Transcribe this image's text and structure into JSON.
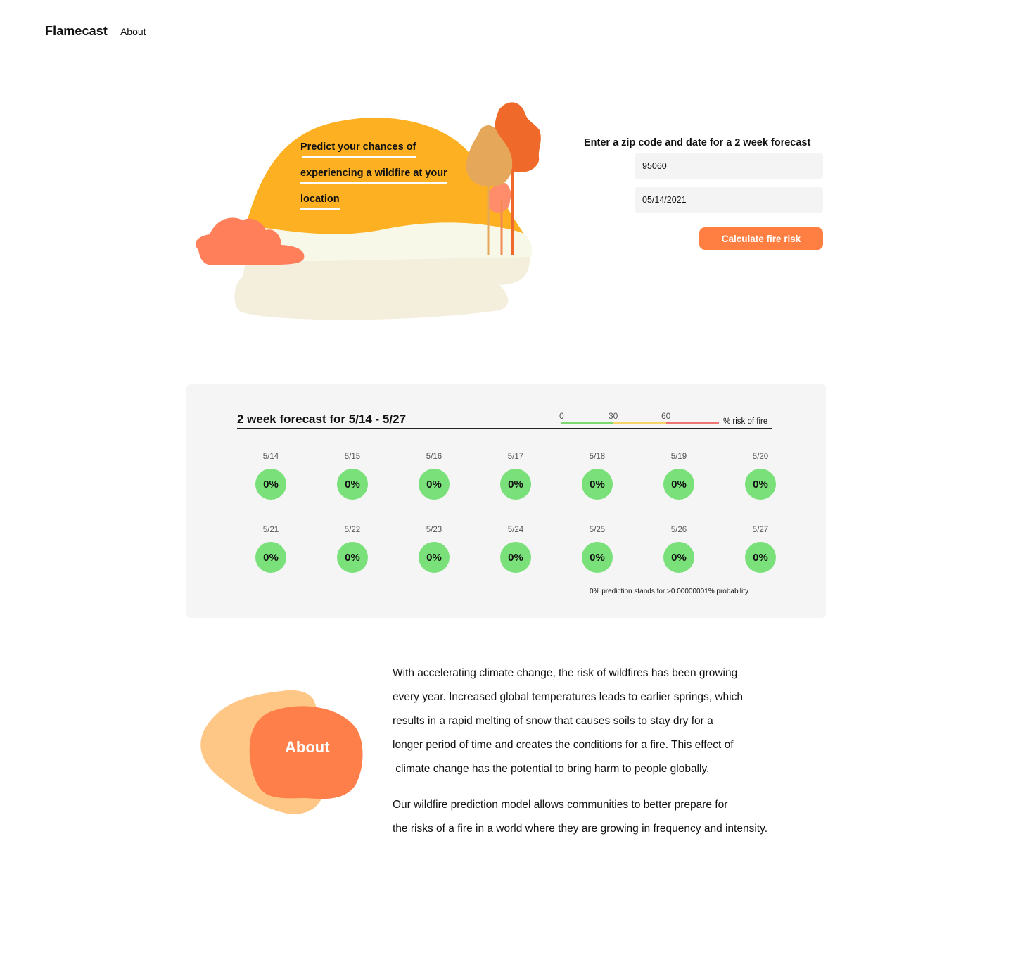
{
  "nav": {
    "brand": "Flamecast",
    "about_link": "About"
  },
  "hero": {
    "lines": [
      "Predict your chances of",
      "experiencing a wildfire at your",
      "location"
    ]
  },
  "form": {
    "title": "Enter a zip code and date for a 2 week forecast",
    "zip_value": "95060",
    "date_value": "05/14/2021",
    "button_label": "Calculate fire risk"
  },
  "forecast": {
    "title": "2 week forecast for 5/14 - 5/27",
    "legend": {
      "ticks": [
        "0",
        "30",
        "60"
      ],
      "unit": "% risk of fire"
    },
    "days": [
      {
        "date": "5/14",
        "risk": "0%"
      },
      {
        "date": "5/15",
        "risk": "0%"
      },
      {
        "date": "5/16",
        "risk": "0%"
      },
      {
        "date": "5/17",
        "risk": "0%"
      },
      {
        "date": "5/18",
        "risk": "0%"
      },
      {
        "date": "5/19",
        "risk": "0%"
      },
      {
        "date": "5/20",
        "risk": "0%"
      },
      {
        "date": "5/21",
        "risk": "0%"
      },
      {
        "date": "5/22",
        "risk": "0%"
      },
      {
        "date": "5/23",
        "risk": "0%"
      },
      {
        "date": "5/24",
        "risk": "0%"
      },
      {
        "date": "5/25",
        "risk": "0%"
      },
      {
        "date": "5/26",
        "risk": "0%"
      },
      {
        "date": "5/27",
        "risk": "0%"
      }
    ],
    "footnote": "0% prediction stands for >0.00000001% probability."
  },
  "about": {
    "label": "About",
    "p1": [
      "With accelerating climate change, the risk of wildfires has been growing",
      "every year. Increased global temperatures leads to earlier springs, which",
      "results in a rapid melting of snow that causes soils to stay dry for a",
      "longer period of time and creates the conditions for a fire. This effect of",
      " climate change has the potential to bring harm to people globally."
    ],
    "p2": [
      "Our wildfire prediction model allows communities to better prepare for",
      "the risks of a fire in a world where they are growing in frequency and intensity."
    ]
  },
  "colors": {
    "accent": "#ff7f43",
    "hill": "#fdb022",
    "risk_low": "#7ae07a",
    "risk_mid": "#f7d46a",
    "risk_high": "#f07575"
  }
}
